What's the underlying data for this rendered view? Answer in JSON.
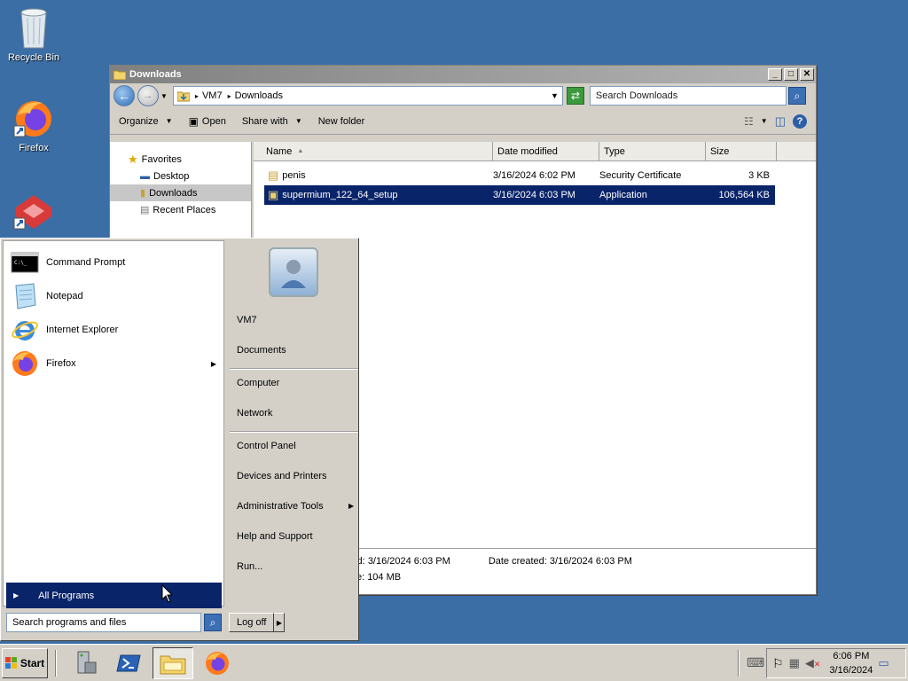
{
  "desktop": {
    "icons": [
      {
        "label": "Recycle Bin",
        "icon": "recycle-bin-icon"
      },
      {
        "label": "Firefox",
        "icon": "firefox-icon"
      },
      {
        "label": "",
        "icon": "app-shortcut-icon"
      }
    ]
  },
  "explorer": {
    "title": "Downloads",
    "address": {
      "root": "VM7",
      "current": "Downloads"
    },
    "search_placeholder": "Search Downloads",
    "toolbar": {
      "organize": "Organize",
      "open": "Open",
      "share_with": "Share with",
      "new_folder": "New folder"
    },
    "nav": {
      "favorites": "Favorites",
      "desktop": "Desktop",
      "downloads": "Downloads",
      "recent_places": "Recent Places"
    },
    "columns": {
      "name": "Name",
      "date_modified": "Date modified",
      "type": "Type",
      "size": "Size"
    },
    "files": [
      {
        "name": "penis",
        "date": "3/16/2024 6:02 PM",
        "type": "Security Certificate",
        "size": "3 KB",
        "selected": false
      },
      {
        "name": "supermium_122_64_setup",
        "date": "3/16/2024 6:03 PM",
        "type": "Application",
        "size": "106,564 KB",
        "selected": true
      }
    ],
    "details": {
      "modified_label": "ied:",
      "modified_value": "3/16/2024 6:03 PM",
      "created_label": "Date created:",
      "created_value": "3/16/2024 6:03 PM",
      "size_label": "ize:",
      "size_value": "104 MB"
    }
  },
  "start_menu": {
    "programs": [
      {
        "label": "Command Prompt",
        "icon": "command-prompt-icon"
      },
      {
        "label": "Notepad",
        "icon": "notepad-icon"
      },
      {
        "label": "Internet Explorer",
        "icon": "internet-explorer-icon"
      },
      {
        "label": "Firefox",
        "icon": "firefox-icon",
        "has_submenu": true
      }
    ],
    "all_programs": "All Programs",
    "search_placeholder": "Search programs and files",
    "right": {
      "user": "VM7",
      "documents": "Documents",
      "computer": "Computer",
      "network": "Network",
      "control_panel": "Control Panel",
      "devices_printers": "Devices and Printers",
      "admin_tools": "Administrative Tools",
      "help_support": "Help and Support",
      "run": "Run..."
    },
    "log_off": "Log off"
  },
  "taskbar": {
    "start": "Start",
    "time": "6:06 PM",
    "date": "3/16/2024"
  },
  "colors": {
    "desktop": "#3a6ea5",
    "selection": "#0a246a",
    "chrome": "#d4d0c8"
  }
}
